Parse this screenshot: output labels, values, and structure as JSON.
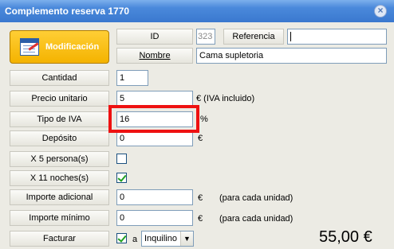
{
  "window": {
    "title": "Complemento reserva 1770",
    "close_icon": "close-icon"
  },
  "toolbar": {
    "mode_label": "Modificación",
    "mode_icon": "edit-form-icon"
  },
  "header": {
    "id_label": "ID",
    "id_value": "323",
    "referencia_label": "Referencia",
    "referencia_value": "",
    "nombre_label": "Nombre",
    "nombre_value": "Cama supletoria"
  },
  "fields": {
    "cantidad": {
      "label": "Cantidad",
      "value": "1"
    },
    "precio_unitario": {
      "label": "Precio unitario",
      "value": "5",
      "suffix": "€ (IVA incluido)"
    },
    "tipo_iva": {
      "label": "Tipo de IVA",
      "value": "16",
      "suffix": "%"
    },
    "deposito": {
      "label": "Depósito",
      "value": "0",
      "suffix": "€"
    },
    "x_personas": {
      "label": "X 5 persona(s)",
      "checked": false
    },
    "x_noches": {
      "label": "X 11 noches(s)",
      "checked": true
    },
    "importe_adicional": {
      "label": "Importe adicional",
      "value": "0",
      "currency": "€",
      "note": "(para cada unidad)"
    },
    "importe_minimo": {
      "label": "Importe mínimo",
      "value": "0",
      "currency": "€",
      "note": "(para cada unidad)"
    },
    "facturar": {
      "label": "Facturar",
      "checked": true,
      "connector": "a",
      "selected": "Inquilino"
    }
  },
  "total": "55,00 €",
  "colors": {
    "titlebar": "#3a78cf",
    "mode_button": "#f4b300",
    "highlight": "#ee1111"
  }
}
